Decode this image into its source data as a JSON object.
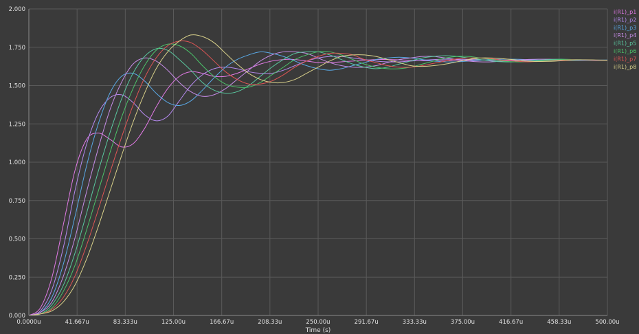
{
  "chart_data": {
    "type": "line",
    "xlabel": "Time (s)",
    "ylabel": "",
    "xlim": [
      0,
      500
    ],
    "ylim": [
      0,
      2.0
    ],
    "grid": true,
    "legend_position": "top-right",
    "background_color": "#3a3a3a",
    "grid_color": "#5a5a5a",
    "axis_text_color": "#e0e0e0",
    "x_ticks": [
      0,
      41.667,
      83.333,
      125,
      166.67,
      208.33,
      250,
      291.67,
      333.33,
      375,
      416.67,
      458.33,
      500
    ],
    "x_tick_labels": [
      "0.0000u",
      "41.667u",
      "83.333u",
      "125.00u",
      "166.67u",
      "208.33u",
      "250.00u",
      "291.67u",
      "333.33u",
      "375.00u",
      "416.67u",
      "458.33u",
      "500.00u"
    ],
    "y_ticks": [
      0,
      0.25,
      0.5,
      0.75,
      1.0,
      1.25,
      1.5,
      1.75,
      2.0
    ],
    "y_tick_labels": [
      "0.000",
      "0.250",
      "0.500",
      "0.750",
      "1.000",
      "1.250",
      "1.500",
      "1.750",
      "2.000"
    ],
    "x": [
      0,
      10,
      20,
      30,
      40,
      50,
      60,
      70,
      80,
      90,
      100,
      110,
      120,
      130,
      140,
      150,
      160,
      170,
      180,
      190,
      200,
      210,
      220,
      230,
      240,
      250,
      260,
      270,
      280,
      290,
      300,
      310,
      320,
      330,
      340,
      350,
      360,
      370,
      380,
      390,
      400,
      410,
      420,
      430,
      440,
      450,
      460,
      470,
      480,
      490,
      500
    ],
    "series": [
      {
        "name": "i(R1)_p1",
        "color": "#e27ae6",
        "values": [
          0.0,
          0.05,
          0.25,
          0.6,
          0.95,
          1.15,
          1.19,
          1.15,
          1.1,
          1.12,
          1.22,
          1.36,
          1.48,
          1.56,
          1.59,
          1.58,
          1.56,
          1.56,
          1.58,
          1.61,
          1.64,
          1.66,
          1.67,
          1.67,
          1.66,
          1.65,
          1.65,
          1.655,
          1.66,
          1.665,
          1.67,
          1.67,
          1.668,
          1.665,
          1.662,
          1.661,
          1.662,
          1.664,
          1.666,
          1.667,
          1.667,
          1.666,
          1.665,
          1.664,
          1.664,
          1.665,
          1.666,
          1.666,
          1.666,
          1.665,
          1.665
        ]
      },
      {
        "name": "i(R1)_p2",
        "color": "#b68af0",
        "values": [
          0.0,
          0.03,
          0.17,
          0.45,
          0.82,
          1.12,
          1.32,
          1.42,
          1.44,
          1.39,
          1.31,
          1.27,
          1.3,
          1.4,
          1.5,
          1.57,
          1.61,
          1.62,
          1.61,
          1.59,
          1.58,
          1.58,
          1.6,
          1.63,
          1.66,
          1.68,
          1.69,
          1.69,
          1.68,
          1.67,
          1.66,
          1.655,
          1.655,
          1.66,
          1.665,
          1.67,
          1.672,
          1.672,
          1.67,
          1.668,
          1.665,
          1.663,
          1.663,
          1.664,
          1.666,
          1.667,
          1.668,
          1.667,
          1.666,
          1.665,
          1.665
        ]
      },
      {
        "name": "i(R1)_p3",
        "color": "#5aa9e6",
        "values": [
          0.0,
          0.02,
          0.12,
          0.34,
          0.65,
          0.98,
          1.25,
          1.45,
          1.56,
          1.58,
          1.53,
          1.45,
          1.39,
          1.37,
          1.4,
          1.47,
          1.55,
          1.62,
          1.67,
          1.7,
          1.72,
          1.71,
          1.69,
          1.66,
          1.63,
          1.61,
          1.6,
          1.61,
          1.63,
          1.65,
          1.67,
          1.68,
          1.685,
          1.68,
          1.67,
          1.66,
          1.655,
          1.655,
          1.66,
          1.665,
          1.67,
          1.672,
          1.672,
          1.67,
          1.667,
          1.665,
          1.664,
          1.664,
          1.665,
          1.666,
          1.667
        ]
      },
      {
        "name": "i(R1)_p4",
        "color": "#c78de8",
        "values": [
          0.0,
          0.02,
          0.09,
          0.26,
          0.51,
          0.81,
          1.09,
          1.34,
          1.52,
          1.64,
          1.68,
          1.66,
          1.6,
          1.52,
          1.46,
          1.43,
          1.44,
          1.48,
          1.54,
          1.6,
          1.66,
          1.7,
          1.72,
          1.72,
          1.71,
          1.68,
          1.65,
          1.63,
          1.62,
          1.62,
          1.63,
          1.65,
          1.67,
          1.68,
          1.69,
          1.69,
          1.68,
          1.67,
          1.66,
          1.655,
          1.655,
          1.66,
          1.665,
          1.67,
          1.672,
          1.672,
          1.67,
          1.668,
          1.666,
          1.665,
          1.665
        ]
      },
      {
        "name": "i(R1)_p5",
        "color": "#5ac8a0",
        "values": [
          0.0,
          0.01,
          0.07,
          0.2,
          0.41,
          0.67,
          0.94,
          1.19,
          1.41,
          1.58,
          1.69,
          1.74,
          1.73,
          1.67,
          1.6,
          1.52,
          1.47,
          1.45,
          1.46,
          1.5,
          1.56,
          1.62,
          1.67,
          1.71,
          1.72,
          1.72,
          1.7,
          1.67,
          1.64,
          1.62,
          1.61,
          1.62,
          1.64,
          1.66,
          1.68,
          1.69,
          1.695,
          1.69,
          1.68,
          1.67,
          1.66,
          1.655,
          1.655,
          1.66,
          1.665,
          1.67,
          1.672,
          1.67,
          1.668,
          1.666,
          1.665
        ]
      },
      {
        "name": "i(R1)_p6",
        "color": "#4cc46a",
        "values": [
          0.0,
          0.01,
          0.05,
          0.16,
          0.33,
          0.56,
          0.81,
          1.06,
          1.29,
          1.48,
          1.63,
          1.73,
          1.77,
          1.76,
          1.71,
          1.63,
          1.56,
          1.51,
          1.49,
          1.49,
          1.52,
          1.57,
          1.62,
          1.67,
          1.7,
          1.72,
          1.72,
          1.7,
          1.67,
          1.64,
          1.62,
          1.61,
          1.61,
          1.62,
          1.64,
          1.66,
          1.68,
          1.69,
          1.69,
          1.68,
          1.67,
          1.66,
          1.655,
          1.655,
          1.66,
          1.665,
          1.67,
          1.67,
          1.668,
          1.666,
          1.665
        ]
      },
      {
        "name": "i(R1)_p7",
        "color": "#e05555",
        "values": [
          0.0,
          0.01,
          0.04,
          0.12,
          0.26,
          0.46,
          0.69,
          0.93,
          1.16,
          1.37,
          1.55,
          1.68,
          1.76,
          1.79,
          1.78,
          1.73,
          1.66,
          1.59,
          1.54,
          1.51,
          1.51,
          1.53,
          1.57,
          1.62,
          1.66,
          1.69,
          1.71,
          1.71,
          1.7,
          1.67,
          1.65,
          1.63,
          1.62,
          1.62,
          1.63,
          1.645,
          1.66,
          1.675,
          1.68,
          1.68,
          1.675,
          1.665,
          1.66,
          1.655,
          1.657,
          1.66,
          1.665,
          1.668,
          1.668,
          1.666,
          1.665
        ]
      },
      {
        "name": "i(R1)_p8",
        "color": "#d8d08a",
        "values": [
          0.0,
          0.01,
          0.03,
          0.09,
          0.2,
          0.37,
          0.58,
          0.81,
          1.04,
          1.26,
          1.45,
          1.61,
          1.72,
          1.79,
          1.83,
          1.82,
          1.78,
          1.71,
          1.64,
          1.58,
          1.54,
          1.52,
          1.52,
          1.54,
          1.58,
          1.62,
          1.66,
          1.69,
          1.7,
          1.7,
          1.69,
          1.67,
          1.65,
          1.63,
          1.625,
          1.63,
          1.64,
          1.655,
          1.67,
          1.68,
          1.68,
          1.675,
          1.668,
          1.66,
          1.657,
          1.658,
          1.662,
          1.666,
          1.668,
          1.667,
          1.666
        ]
      }
    ]
  }
}
